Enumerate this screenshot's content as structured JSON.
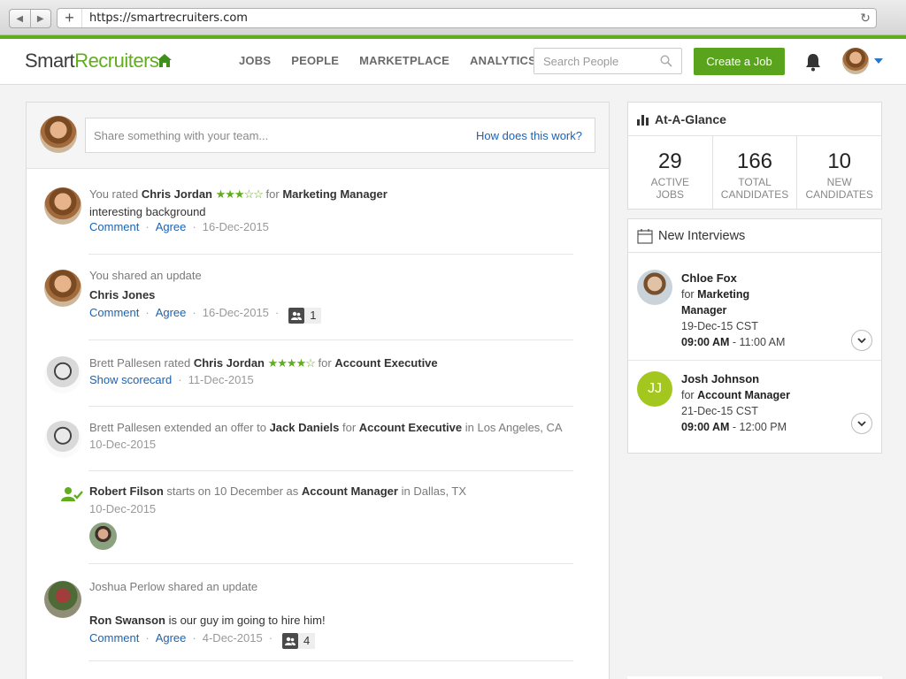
{
  "browser": {
    "url": "https://smartrecruiters.com"
  },
  "nav": {
    "logo_part1": "Smart",
    "logo_part2": "Recruiters",
    "menu": [
      "JOBS",
      "PEOPLE",
      "MARKETPLACE",
      "ANALYTICS"
    ],
    "search_placeholder": "Search People",
    "create_button": "Create a Job"
  },
  "composer": {
    "placeholder": "Share something with your team...",
    "help_link": "How does this work?"
  },
  "feed": [
    {
      "actor": "You rated",
      "name": "Chris Jordan",
      "stars": 3,
      "for_word": "for",
      "job": "Marketing Manager",
      "body": "interesting background",
      "comment": "Comment",
      "agree": "Agree",
      "date": "16-Dec-2015"
    },
    {
      "actor": "You shared an update",
      "title": "Chris Jones",
      "comment": "Comment",
      "agree": "Agree",
      "date": "16-Dec-2015",
      "share_count": "1"
    },
    {
      "actor": "Brett Pallesen rated",
      "name": "Chris Jordan",
      "stars": 4,
      "for_word": "for",
      "job": "Account Executive",
      "scorecard": "Show scorecard",
      "date": "11-Dec-2015"
    },
    {
      "actor": "Brett Pallesen extended an offer to",
      "name": "Jack Daniels",
      "for_word": "for",
      "job": "Account Executive",
      "location": "in Los Angeles, CA",
      "date": "10-Dec-2015"
    },
    {
      "name": "Robert Filson",
      "middle": "starts on 10 December as",
      "job": "Account Manager",
      "location": "in Dallas, TX",
      "date": "10-Dec-2015"
    },
    {
      "actor": "Joshua Perlow shared an update",
      "name": "Ron Swanson",
      "body": "is our guy im going to hire him!",
      "comment": "Comment",
      "agree": "Agree",
      "date": "4-Dec-2015",
      "share_count": "4"
    }
  ],
  "glance": {
    "title": "At-A-Glance",
    "stats": [
      {
        "value": "29",
        "label1": "ACTIVE",
        "label2": "JOBS"
      },
      {
        "value": "166",
        "label1": "TOTAL",
        "label2": "CANDIDATES"
      },
      {
        "value": "10",
        "label1": "NEW",
        "label2": "CANDIDATES"
      }
    ]
  },
  "interviews": {
    "title": "New Interviews",
    "items": [
      {
        "name": "Chloe Fox",
        "for_word": "for",
        "job_line1": "Marketing",
        "job_line2": "Manager",
        "date": "19-Dec-15 CST",
        "start": "09:00 AM",
        "end": "- 11:00 AM"
      },
      {
        "initials": "JJ",
        "name": "Josh Johnson",
        "for_word": "for",
        "job_line1": "Account Manager",
        "date": "21-Dec-15 CST",
        "start": "09:00 AM",
        "end": "- 12:00 PM"
      }
    ]
  },
  "colors": {
    "brand_green": "#61ad1e",
    "link_blue": "#1a63b4",
    "star_green": "#61ad1e"
  },
  "icons": [
    "home-icon",
    "search-icon",
    "bell-icon",
    "chart-icon",
    "calendar-icon",
    "share-icon",
    "hire-icon",
    "chevron-down-icon"
  ]
}
